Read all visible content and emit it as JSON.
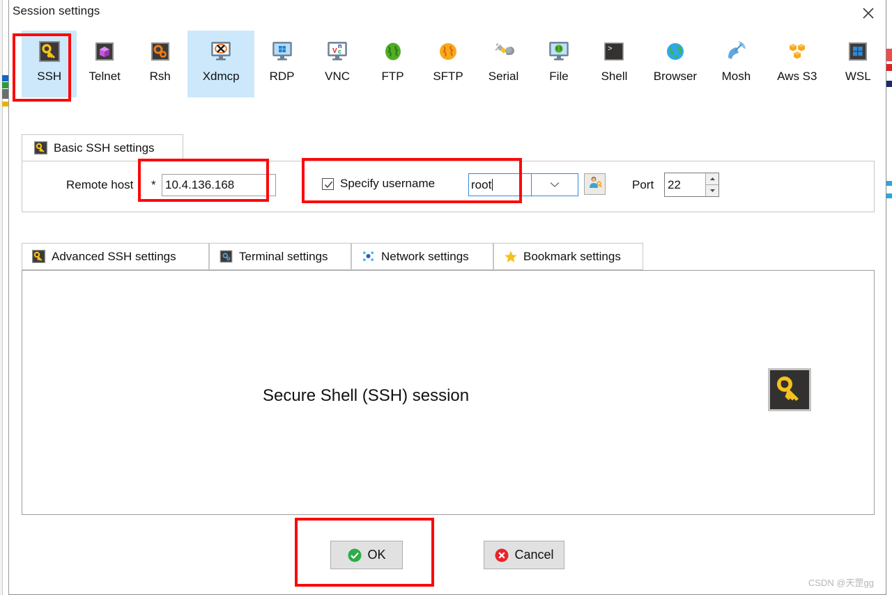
{
  "window": {
    "title": "Session settings",
    "close_icon": "close-x-icon"
  },
  "protocols": {
    "items": [
      {
        "label": "SSH",
        "icon": "key-icon",
        "selected": true,
        "annotated": true
      },
      {
        "label": "Telnet",
        "icon": "purple-gem-icon",
        "selected": false,
        "annotated": false
      },
      {
        "label": "Rsh",
        "icon": "orange-gears-icon",
        "selected": false,
        "annotated": false
      },
      {
        "label": "Xdmcp",
        "icon": "x-monitor-icon",
        "selected": true,
        "annotated": false
      },
      {
        "label": "RDP",
        "icon": "windows-monitor-icon",
        "selected": false,
        "annotated": false
      },
      {
        "label": "VNC",
        "icon": "vnc-monitor-icon",
        "selected": false,
        "annotated": false
      },
      {
        "label": "FTP",
        "icon": "green-globe-icon",
        "selected": false,
        "annotated": false
      },
      {
        "label": "SFTP",
        "icon": "orange-globe-icon",
        "selected": false,
        "annotated": false
      },
      {
        "label": "Serial",
        "icon": "plug-icon",
        "selected": false,
        "annotated": false
      },
      {
        "label": "File",
        "icon": "globe-monitor-icon",
        "selected": false,
        "annotated": false
      },
      {
        "label": "Shell",
        "icon": "terminal-prompt-icon",
        "selected": false,
        "annotated": false
      },
      {
        "label": "Browser",
        "icon": "blue-globe-icon",
        "selected": false,
        "annotated": false
      },
      {
        "label": "Mosh",
        "icon": "satellite-dish-icon",
        "selected": false,
        "annotated": false
      },
      {
        "label": "Aws S3",
        "icon": "aws-cubes-icon",
        "selected": false,
        "annotated": false
      },
      {
        "label": "WSL",
        "icon": "windows-logo-icon",
        "selected": false,
        "annotated": false
      }
    ]
  },
  "basic_ssh": {
    "group_label": "Basic SSH settings",
    "group_icon": "key-icon",
    "remote_host_label": "Remote host",
    "remote_host_required_mark": "*",
    "remote_host_value": "10.4.136.168",
    "specify_username_label": "Specify username",
    "specify_username_checked": true,
    "username_value": "root",
    "username_dropdown_icon": "chevron-down-icon",
    "user_button_icon": "user-key-icon",
    "port_label": "Port",
    "port_value": "22",
    "spinner_up_icon": "triangle-up-icon",
    "spinner_down_icon": "triangle-down-icon"
  },
  "sub_tabs": [
    {
      "label": "Advanced SSH settings",
      "icon": "key-icon"
    },
    {
      "label": "Terminal settings",
      "icon": "terminal-blue-icon"
    },
    {
      "label": "Network settings",
      "icon": "network-dots-icon"
    },
    {
      "label": "Bookmark settings",
      "icon": "star-icon"
    }
  ],
  "content": {
    "title": "Secure Shell (SSH) session",
    "key_icon": "key-icon"
  },
  "buttons": {
    "ok_label": "OK",
    "ok_icon": "green-check-icon",
    "cancel_label": "Cancel",
    "cancel_icon": "red-x-icon"
  },
  "watermark": "CSDN @天罡gg",
  "colors": {
    "annotation": "#fb0a0a",
    "selected_tab": "#cde8fa",
    "focus_border": "#2e8ad8",
    "key_yellow": "#f5c11e",
    "ok_green": "#2cad47",
    "cancel_red": "#e8232a"
  }
}
